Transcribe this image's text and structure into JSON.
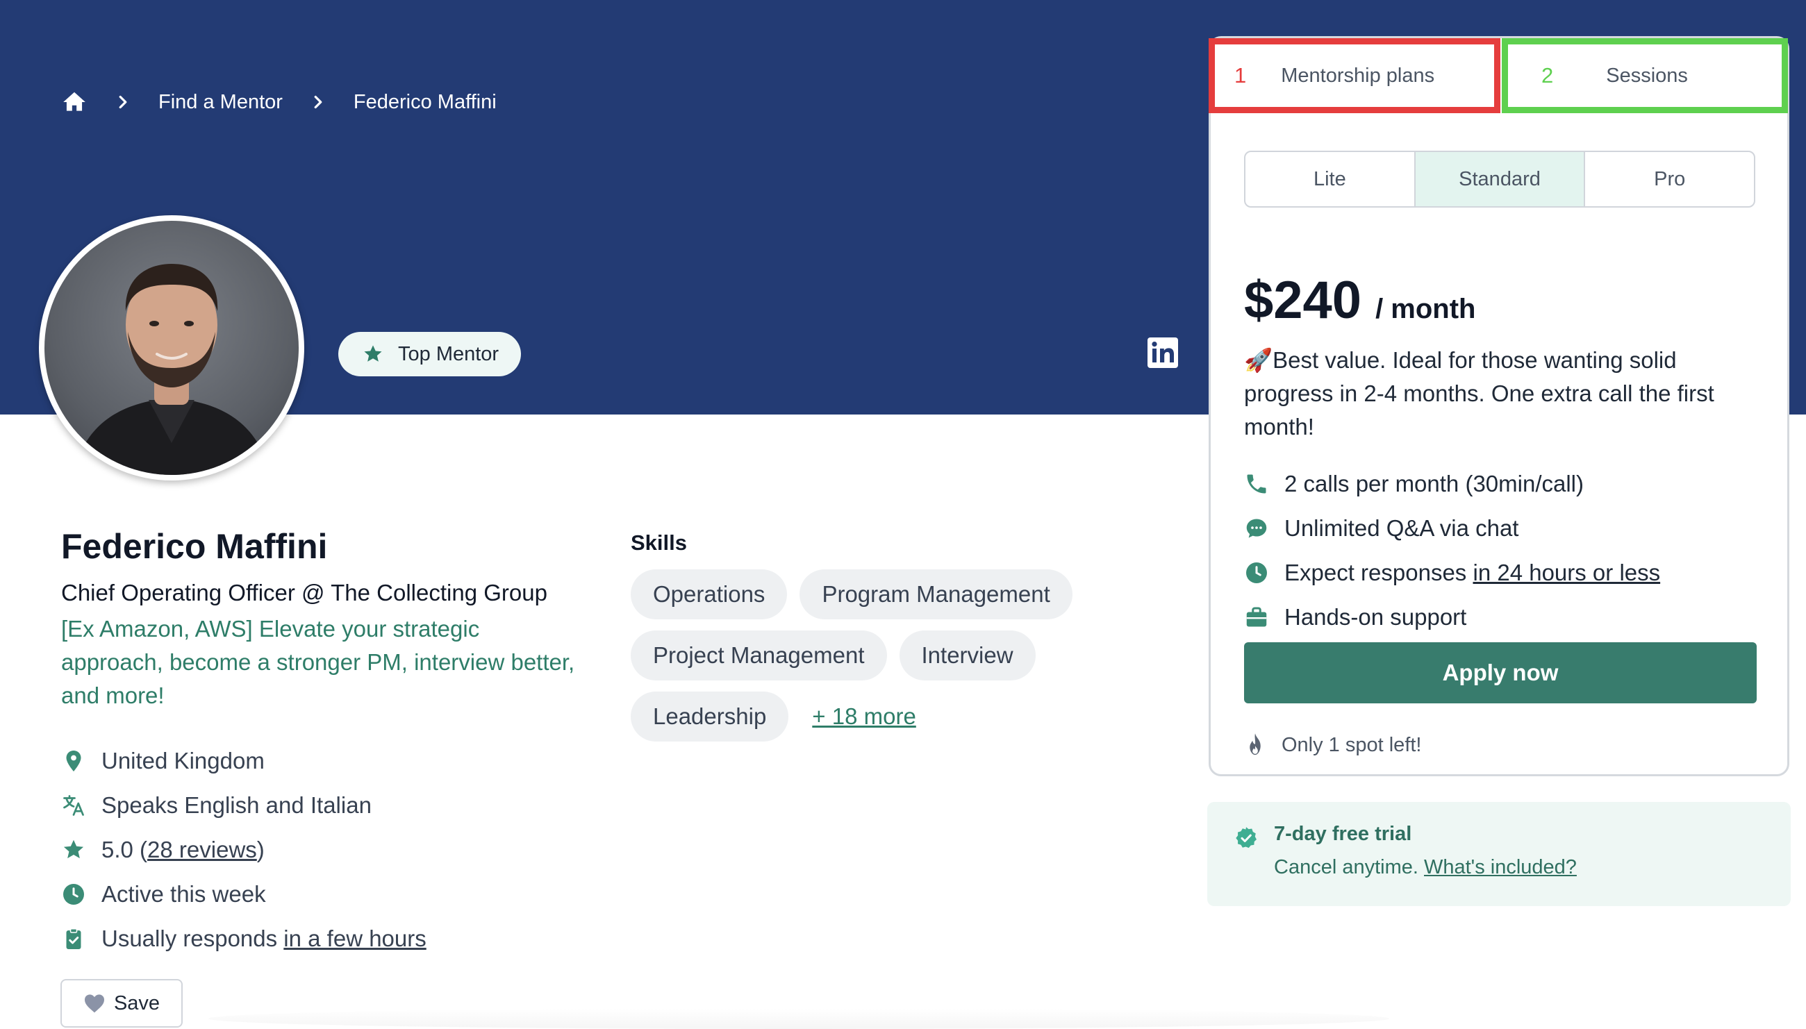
{
  "breadcrumb": {
    "home_icon": "home-icon",
    "items": [
      "Find a Mentor",
      "Federico Maffini"
    ]
  },
  "profile": {
    "badge": "Top Mentor",
    "name": "Federico Maffini",
    "headline": "Chief Operating Officer @ The Collecting Group",
    "tagline": "[Ex Amazon, AWS] Elevate your strategic approach, become a stronger PM, interview better, and more!",
    "location": "United Kingdom",
    "languages": "Speaks English and Italian",
    "rating": "5.0",
    "reviews_link": "28 reviews",
    "activity": "Active this week",
    "responds_prefix": "Usually responds",
    "responds_link": "in a few hours",
    "save_label": "Save"
  },
  "skills": {
    "title": "Skills",
    "items": [
      "Operations",
      "Program Management",
      "Project Management",
      "Interview",
      "Leadership"
    ],
    "more_link": "+ 18 more"
  },
  "plan_card": {
    "tabs": [
      {
        "num": "1",
        "label": "Mentorship plans"
      },
      {
        "num": "2",
        "label": "Sessions"
      }
    ],
    "plan_options": [
      "Lite",
      "Standard",
      "Pro"
    ],
    "selected_plan": "Standard",
    "price": "$240",
    "period": "/ month",
    "description": "🚀Best value. Ideal for those wanting solid progress in 2-4 months. One extra call the first month!",
    "features": {
      "calls": "2 calls per month (30min/call)",
      "chat": "Unlimited Q&A via chat",
      "responses_prefix": "Expect responses",
      "responses_link": "in 24 hours or less",
      "support": "Hands-on support"
    },
    "apply_label": "Apply now",
    "spots_left": "Only 1 spot left!"
  },
  "trial": {
    "title": "7-day free trial",
    "subtitle_prefix": "Cancel anytime.",
    "subtitle_link": "What's included?"
  },
  "colors": {
    "banner": "#233b74",
    "accent": "#387c6d",
    "tab1_highlight": "#e53d3d",
    "tab2_highlight": "#5ed04f"
  }
}
